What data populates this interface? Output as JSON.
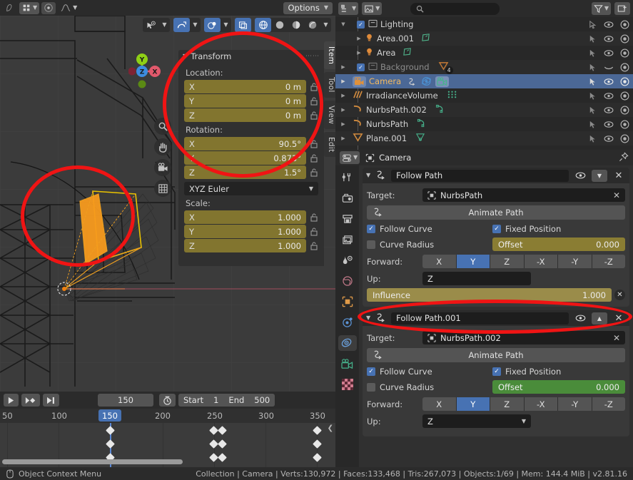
{
  "app": {
    "version_status": "Collection | Camera | Verts:130,972 | Faces:133,468 | Tris:267,073 | Objects:1/69 | Mem: 144.4 MiB | v2.81.16"
  },
  "tool_header": {
    "options_label": "Options"
  },
  "viewport": {
    "gizmo_axes": [
      "X",
      "Y",
      "Z"
    ],
    "side_tabs": [
      {
        "label": "Item",
        "active": true
      },
      {
        "label": "Tool",
        "active": false
      },
      {
        "label": "View",
        "active": false
      },
      {
        "label": "Edit",
        "active": false
      }
    ]
  },
  "n_panel": {
    "title": "Transform",
    "location_label": "Location:",
    "location": [
      {
        "axis": "X",
        "value": "0 m"
      },
      {
        "axis": "Y",
        "value": "0 m"
      },
      {
        "axis": "Z",
        "value": "0 m"
      }
    ],
    "rotation_label": "Rotation:",
    "rotation": [
      {
        "axis": "X",
        "value": "90.5°"
      },
      {
        "axis": "Y",
        "value": "0.873°"
      },
      {
        "axis": "Z",
        "value": "1.5°"
      }
    ],
    "rotation_mode": "XYZ Euler",
    "scale_label": "Scale:",
    "scale": [
      {
        "axis": "X",
        "value": "1.000"
      },
      {
        "axis": "Y",
        "value": "1.000"
      },
      {
        "axis": "Z",
        "value": "1.000"
      }
    ]
  },
  "timeline": {
    "current_frame": "150",
    "start_label": "Start",
    "start_value": "1",
    "end_label": "End",
    "end_value": "500",
    "ruler_ticks": [
      "50",
      "100",
      "150",
      "200",
      "250",
      "300",
      "350"
    ],
    "playhead_label": "150"
  },
  "outliner": {
    "search_placeholder": "",
    "rows": [
      {
        "name": "Lighting",
        "indent": 1,
        "type": "collection",
        "checkbox": true,
        "selected": false,
        "dim": false,
        "badge": ""
      },
      {
        "name": "Area.001",
        "indent": 2,
        "type": "light",
        "checkbox": false,
        "selected": false,
        "dim": false,
        "badge": ""
      },
      {
        "name": "Area",
        "indent": 2,
        "type": "light",
        "checkbox": false,
        "selected": false,
        "dim": false,
        "badge": ""
      },
      {
        "name": "Background",
        "indent": 1,
        "type": "collection",
        "checkbox": true,
        "selected": false,
        "dim": true,
        "badge": "4"
      },
      {
        "name": "Camera",
        "indent": 1,
        "type": "camera",
        "checkbox": false,
        "selected": true,
        "dim": false,
        "badge": ""
      },
      {
        "name": "IrradianceVolume",
        "indent": 1,
        "type": "lightprobe",
        "checkbox": false,
        "selected": false,
        "dim": false,
        "badge": ""
      },
      {
        "name": "NurbsPath.002",
        "indent": 1,
        "type": "curve",
        "checkbox": false,
        "selected": false,
        "dim": false,
        "badge": ""
      },
      {
        "name": "NurbsPath",
        "indent": 1,
        "type": "curve",
        "checkbox": false,
        "selected": false,
        "dim": false,
        "badge": ""
      },
      {
        "name": "Plane.001",
        "indent": 1,
        "type": "mesh",
        "checkbox": false,
        "selected": false,
        "dim": false,
        "badge": ""
      }
    ]
  },
  "properties": {
    "breadcrumb_object": "Camera",
    "constraints": [
      {
        "name": "Follow Path",
        "target_label": "Target:",
        "target_value": "NurbsPath",
        "animate_button": "Animate Path",
        "follow_curve_label": "Follow Curve",
        "follow_curve_checked": true,
        "fixed_position_label": "Fixed Position",
        "fixed_position_checked": true,
        "curve_radius_label": "Curve Radius",
        "curve_radius_checked": false,
        "offset_label": "Offset",
        "offset_value": "0.000",
        "offset_color": "#8a7d33",
        "forward_label": "Forward:",
        "forward_options": [
          "X",
          "Y",
          "Z",
          "-X",
          "-Y",
          "-Z"
        ],
        "forward_selected": "Y",
        "up_label": "Up:",
        "up_value": "Z",
        "influence_label": "Influence",
        "influence_value": "1.000",
        "collapse_state": "expanded-down"
      },
      {
        "name": "Follow Path.001",
        "target_label": "Target:",
        "target_value": "NurbsPath.002",
        "animate_button": "Animate Path",
        "follow_curve_label": "Follow Curve",
        "follow_curve_checked": true,
        "fixed_position_label": "Fixed Position",
        "fixed_position_checked": true,
        "curve_radius_label": "Curve Radius",
        "curve_radius_checked": false,
        "offset_label": "Offset",
        "offset_value": "0.000",
        "offset_color": "#4a8c3a",
        "forward_label": "Forward:",
        "forward_options": [
          "X",
          "Y",
          "Z",
          "-X",
          "-Y",
          "-Z"
        ],
        "forward_selected": "Y",
        "up_label": "Up:",
        "up_value": "Z",
        "influence_label": "",
        "influence_value": "",
        "collapse_state": "expanded-up"
      }
    ]
  },
  "status_bar": {
    "context_menu_label": "Object Context Menu",
    "info": "Collection | Camera | Verts:130,972 | Faces:133,468 | Tris:267,073 | Objects:1/69 | Mem: 144.4 MiB | v2.81.16"
  },
  "colors": {
    "accent_blue": "#4772b3",
    "number_field": "#82752f",
    "influence_field": "#9a8c4a",
    "offset_green": "#4a8c3a",
    "annotation_red": "#f01414",
    "selected_orange": "#f3b95f"
  }
}
